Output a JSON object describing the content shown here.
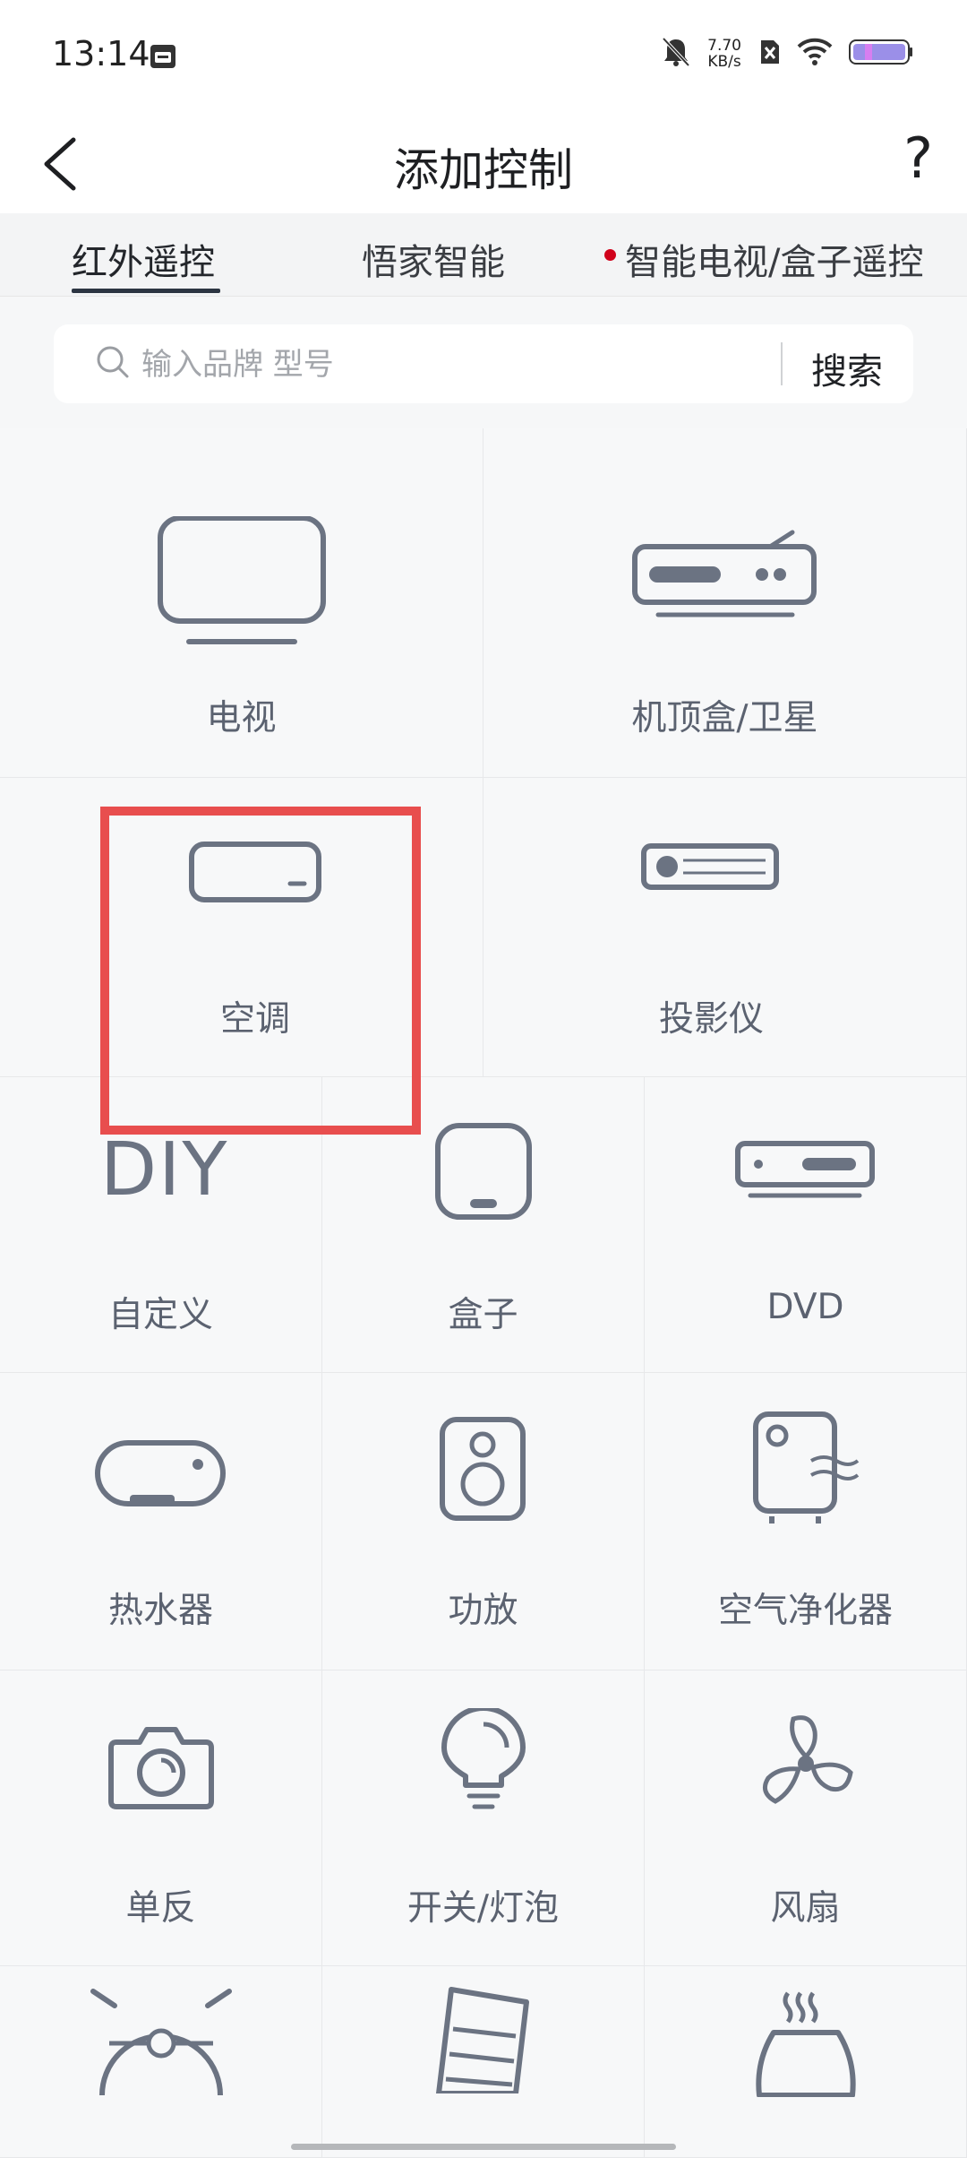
{
  "status_bar": {
    "time": "13:14",
    "network_speed_value": "7.70",
    "network_speed_unit": "KB/s",
    "icons": [
      "calendar-icon",
      "mute-bell-icon",
      "sim-off-icon",
      "wifi-icon",
      "battery-icon"
    ]
  },
  "header": {
    "title": "添加控制",
    "help": "?"
  },
  "tabs": [
    {
      "label": "红外遥控",
      "active": true
    },
    {
      "label": "悟家智能",
      "active": false
    },
    {
      "label": "智能电视/盒子遥控",
      "active": false,
      "badge_dot": true
    }
  ],
  "search": {
    "placeholder": "输入品牌 型号",
    "button": "搜索"
  },
  "devices": [
    {
      "label": "电视",
      "icon": "tv-icon"
    },
    {
      "label": "机顶盒/卫星",
      "icon": "set-top-box-icon"
    },
    {
      "label": "空调",
      "icon": "air-conditioner-icon"
    },
    {
      "label": "投影仪",
      "icon": "projector-icon"
    },
    {
      "label": "自定义",
      "icon": "diy-icon",
      "icon_text": "DIY"
    },
    {
      "label": "盒子",
      "icon": "box-icon"
    },
    {
      "label": "DVD",
      "icon": "dvd-icon"
    },
    {
      "label": "热水器",
      "icon": "water-heater-icon"
    },
    {
      "label": "功放",
      "icon": "amplifier-icon"
    },
    {
      "label": "空气净化器",
      "icon": "air-purifier-icon"
    },
    {
      "label": "单反",
      "icon": "camera-icon"
    },
    {
      "label": "开关/灯泡",
      "icon": "light-bulb-icon"
    },
    {
      "label": "风扇",
      "icon": "fan-icon"
    },
    {
      "label": "",
      "icon": "robot-vacuum-icon"
    },
    {
      "label": "",
      "icon": "heater-icon"
    },
    {
      "label": "",
      "icon": "humidifier-icon"
    }
  ],
  "colors": {
    "highlight": "#e84e4e",
    "icon_stroke": "#6b7382",
    "badge_dot": "#d0021b"
  }
}
